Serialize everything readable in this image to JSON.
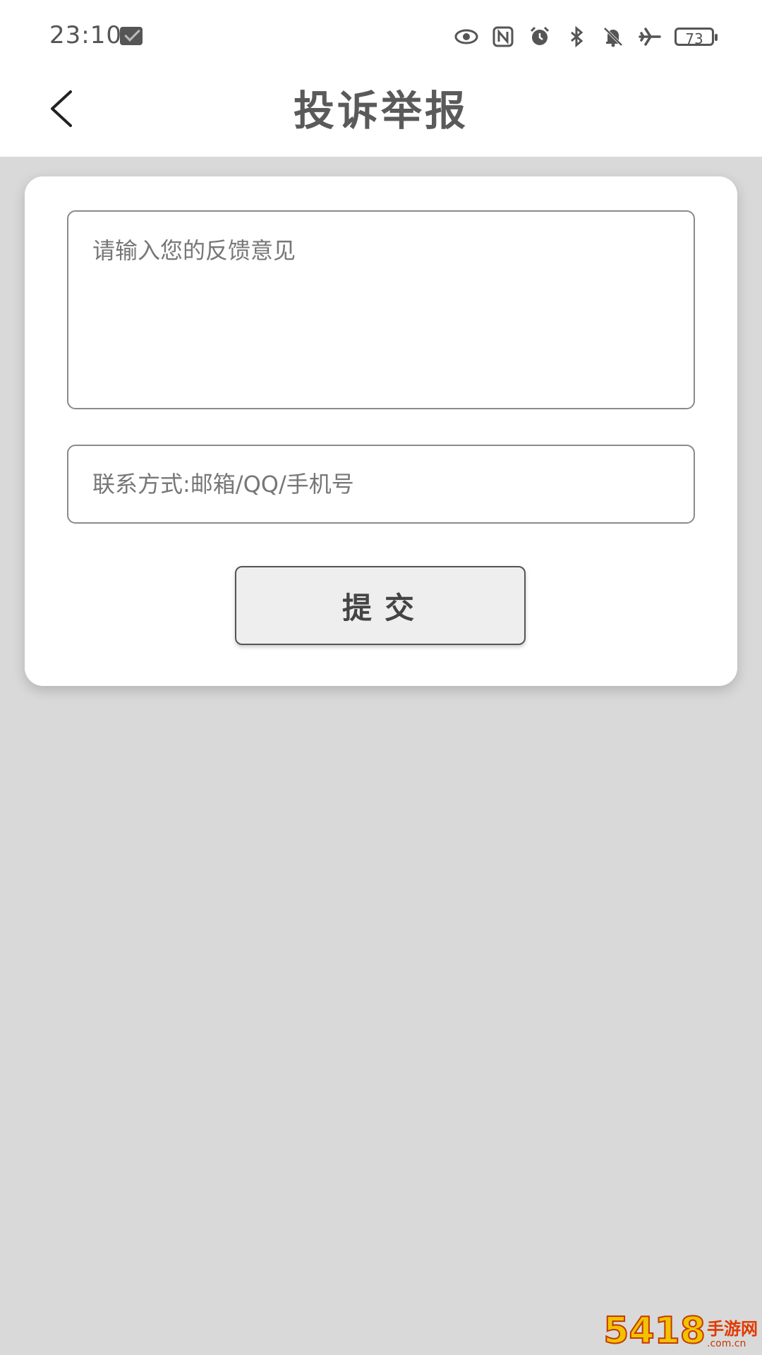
{
  "status_bar": {
    "time": "23:10",
    "battery": "73",
    "icons": [
      "message-app-icon",
      "eye-icon",
      "nfc-icon",
      "alarm-icon",
      "bluetooth-icon",
      "mute-bell-icon",
      "airplane-icon",
      "battery-icon"
    ]
  },
  "header": {
    "title": "投诉举报",
    "back_icon": "chevron-left-icon"
  },
  "form": {
    "feedback_placeholder": "请输入您的反馈意见",
    "feedback_value": "",
    "contact_placeholder": "联系方式:邮箱/QQ/手机号",
    "contact_value": "",
    "submit_label": "提交"
  },
  "watermark": {
    "number": "5418",
    "chinese": "手游网",
    "url": ".com.cn"
  },
  "colors": {
    "background": "#d9d9d9",
    "card": "#ffffff",
    "title": "#5a5a5a",
    "button_bg": "#eeeeee"
  }
}
